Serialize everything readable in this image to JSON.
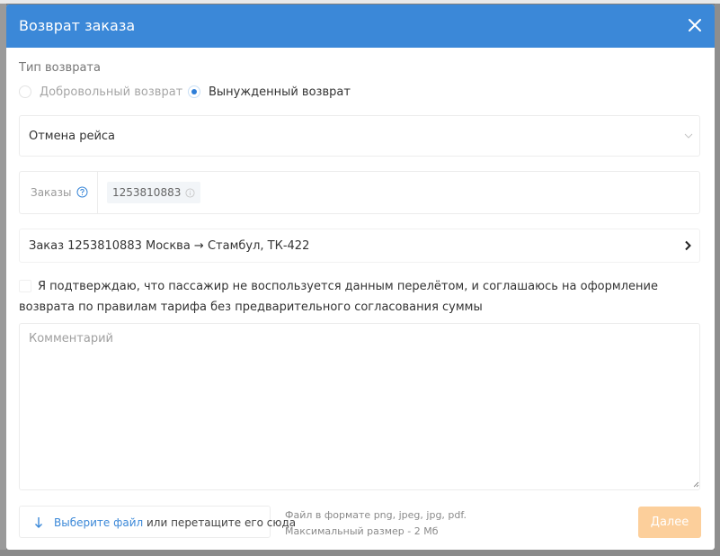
{
  "modal": {
    "title": "Возврат заказа"
  },
  "refund_type": {
    "label": "Тип возврата",
    "options": [
      {
        "label": "Добровольный возврат",
        "selected": false
      },
      {
        "label": "Вынужденный возврат",
        "selected": true
      }
    ]
  },
  "reason": {
    "value": "Отмена рейса"
  },
  "orders": {
    "label": "Заказы",
    "items": [
      "1253810883"
    ]
  },
  "order_route": {
    "text": "Заказ 1253810883 Москва → Стамбул, ТК-422"
  },
  "confirmation": {
    "checked": false,
    "text": "Я подтверждаю, что пассажир не воспользуется данным перелётом, и соглашаюсь на оформление возврата по правилам тарифа без предварительного согласования суммы"
  },
  "comment": {
    "placeholder": "Комментарий"
  },
  "upload": {
    "link_text": "Выберите файл",
    "rest_text": " или перетащите его сюда",
    "hint_line1": "Файл в формате png, jpeg, jpg, pdf.",
    "hint_line2": "Максимальный размер - 2 Мб"
  },
  "actions": {
    "next_label": "Далее"
  },
  "colors": {
    "header": "#3b88d8",
    "accent": "#2f7ed8",
    "next_button": "#fccf9b"
  }
}
